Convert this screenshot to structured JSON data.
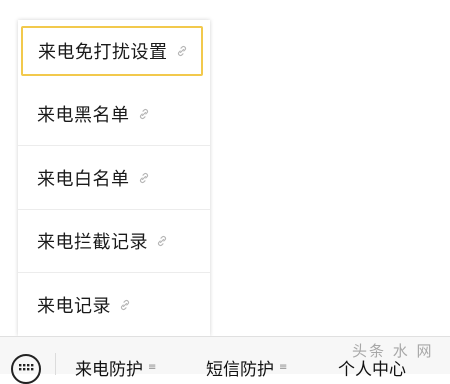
{
  "menu": {
    "items": [
      {
        "label": "来电免打扰设置",
        "selected": true
      },
      {
        "label": "来电黑名单"
      },
      {
        "label": "来电白名单"
      },
      {
        "label": "来电拦截记录"
      },
      {
        "label": "来电记录"
      }
    ]
  },
  "bottom_bar": {
    "tabs": [
      {
        "label": "来电防护"
      },
      {
        "label": "短信防护"
      },
      {
        "label": "个人中心"
      }
    ]
  },
  "watermark": "头条 水 网",
  "colors": {
    "selected_border": "#f2c94c"
  }
}
